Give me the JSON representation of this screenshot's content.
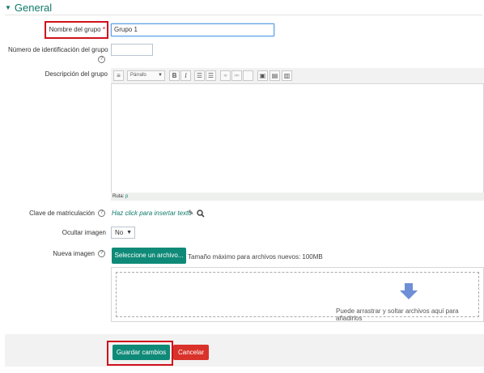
{
  "section": {
    "title": "General"
  },
  "group_name": {
    "label": "Nombre del grupo",
    "required_mark": "*",
    "value": "Grupo 1"
  },
  "id_number": {
    "label": "Número de identificación del grupo",
    "help": "?",
    "value": ""
  },
  "description": {
    "label": "Descripción del grupo",
    "toolbar": {
      "paragraph_select": "Párrafo",
      "bold": "B",
      "italic": "I",
      "buttons": [
        "toggle-toolbar-icon",
        "bold-icon",
        "italic-icon",
        "bullet-list-icon",
        "numbered-list-icon",
        "link-icon",
        "unlink-icon",
        "image-icon",
        "media-icon",
        "file-icon"
      ]
    },
    "path_label": "Ruta:",
    "path_value": "p"
  },
  "enrolment_key": {
    "label": "Clave de matriculación",
    "help": "?",
    "placeholder_link": "Haz click para insertar texto"
  },
  "hide_picture": {
    "label": "Ocultar imagen",
    "value": "No"
  },
  "new_picture": {
    "label": "Nueva imagen",
    "help": "?",
    "choose_button": "Seleccione un archivo...",
    "max_size": "Tamaño máximo para archivos nuevos: 100MB",
    "drop_text": "Puede arrastrar y soltar archivos aquí para añadirlos"
  },
  "actions": {
    "save": "Guardar cambios",
    "cancel": "Cancelar"
  },
  "colors": {
    "accent": "#0f8a78",
    "highlight": "#d0111b",
    "danger": "#d9322a",
    "arrow": "#6e8fd6"
  }
}
